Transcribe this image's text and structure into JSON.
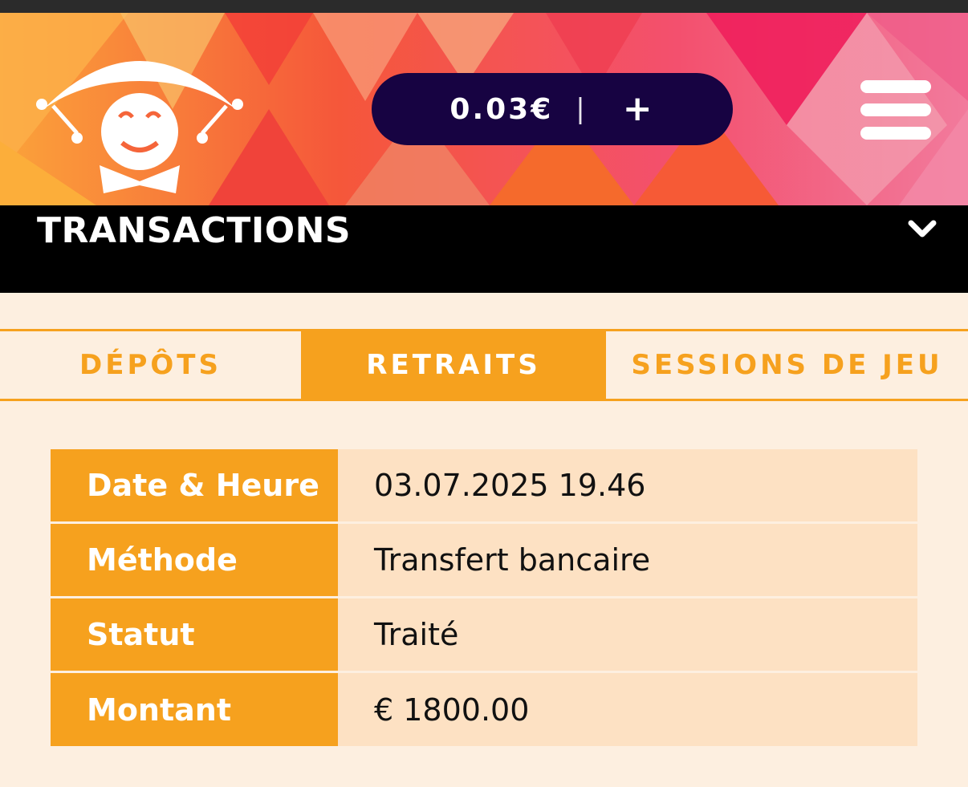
{
  "header": {
    "balance": "0.03€",
    "separator": "|",
    "add_label": "+",
    "logo_icon": "jester-logo-icon",
    "menu_icon": "hamburger-menu-icon"
  },
  "section": {
    "title": "TRANSACTIONS",
    "toggle_icon": "chevron-down-icon"
  },
  "tabs": [
    {
      "label": "DÉPÔTS",
      "active": false
    },
    {
      "label": "RETRAITS",
      "active": true
    },
    {
      "label": "SESSIONS DE JEU",
      "active": false
    }
  ],
  "transaction": {
    "rows": [
      {
        "label": "Date & Heure",
        "value": "03.07.2025 19.46"
      },
      {
        "label": "Méthode",
        "value": "Transfert bancaire"
      },
      {
        "label": "Statut",
        "value": "Traité"
      },
      {
        "label": "Montant",
        "value": "€ 1800.00"
      }
    ]
  },
  "colors": {
    "accent": "#f6a11e",
    "pill": "#170342",
    "row_value_bg": "#fde1c3",
    "page_bg": "#fdefe0"
  }
}
